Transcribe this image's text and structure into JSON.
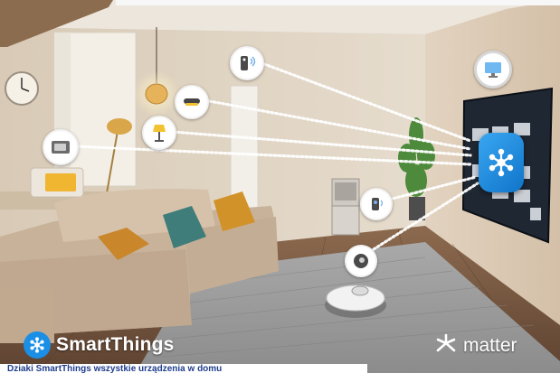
{
  "scene": {
    "palette": {
      "wall": "#e2d5c3",
      "ceiling": "#ece7df",
      "floor": "#7a5a43",
      "rug": "#9a9a9a",
      "sofa": "#cdb8a1",
      "hub_blue": "#1b8fe6",
      "connector_dots": "#ffffff"
    },
    "device_icons": [
      "remote-control-icon",
      "ceiling-light-icon",
      "floor-lamp-icon",
      "oven-icon",
      "tv-monitor-icon",
      "air-purifier-sensor-icon",
      "robot-vacuum-icon"
    ]
  },
  "hub": {
    "icon": "smartthings-hub-icon"
  },
  "branding": {
    "smartthings_label": "SmartThings",
    "matter_label": "matter"
  },
  "caption": {
    "text": "Dziaki SmartThings wszystkie urządzenia w domu"
  }
}
